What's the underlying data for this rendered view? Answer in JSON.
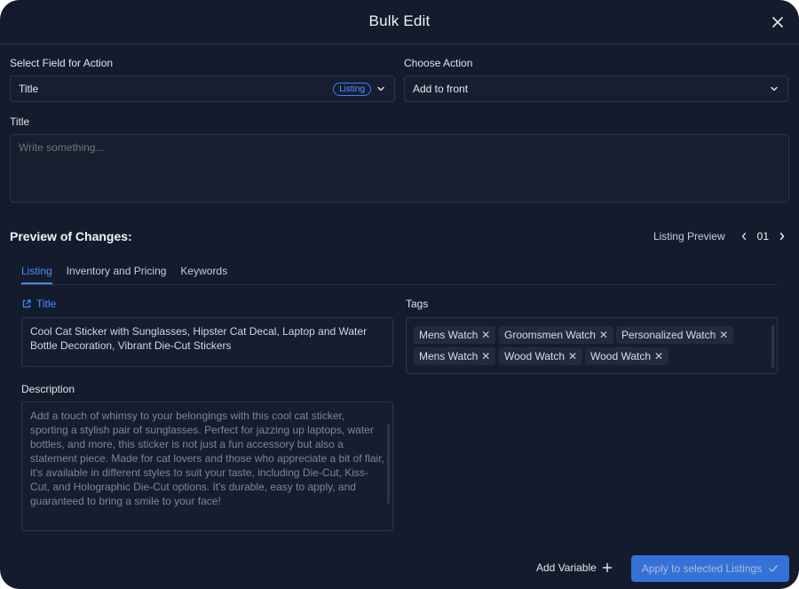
{
  "header": {
    "title": "Bulk Edit"
  },
  "form": {
    "field_label": "Select Field for Action",
    "field_value": "Title",
    "field_badge": "Listing",
    "action_label": "Choose Action",
    "action_value": "Add to front",
    "text_label": "Title",
    "text_placeholder": "Write something..."
  },
  "preview": {
    "title": "Preview of Changes:",
    "pager_label": "Listing Preview",
    "page": "01",
    "tabs": [
      "Listing",
      "Inventory and Pricing",
      "Keywords"
    ],
    "active_tab": 0,
    "title_label": "Title",
    "title_value": "Cool Cat Sticker with Sunglasses, Hipster Cat Decal, Laptop and Water Bottle Decoration, Vibrant Die-Cut Stickers",
    "description_label": "Description",
    "description_value": "Add a touch of whimsy to your belongings with this cool cat sticker, sporting a stylish pair of sunglasses. Perfect for jazzing up laptops, water bottles, and more, this sticker is not just a fun accessory but also a statement piece. Made for cat lovers and those who appreciate a bit of flair, it's available in different styles to suit your taste, including Die-Cut, Kiss-Cut, and Holographic Die-Cut options. It's durable, easy to apply, and guaranteed to bring a smile to your face!",
    "tags_label": "Tags",
    "tags": [
      "Mens Watch",
      "Groomsmen Watch",
      "Personalized Watch",
      "Mens Watch",
      "Wood Watch",
      "Wood Watch"
    ]
  },
  "footer": {
    "add_variable": "Add Variable",
    "apply": "Apply to selected Listings"
  },
  "colors": {
    "accent": "#3b82f6",
    "background": "#141b2c",
    "border": "#2c364b"
  }
}
